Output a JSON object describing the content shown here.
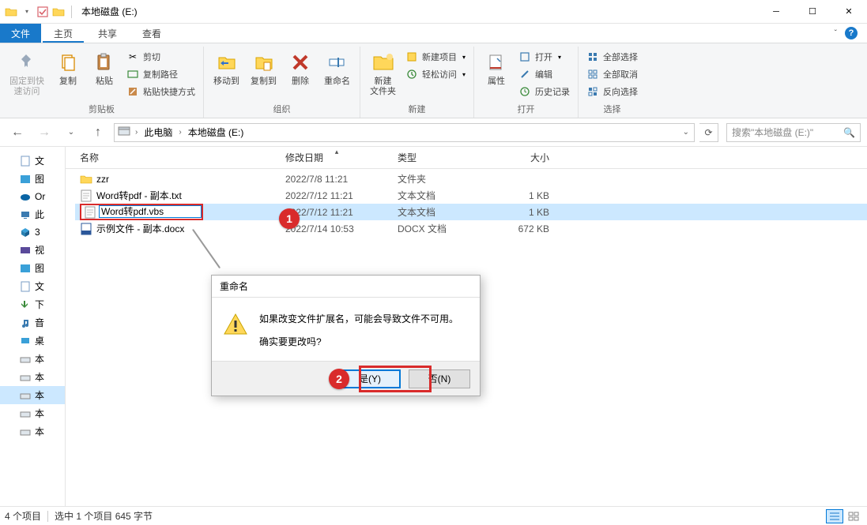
{
  "window": {
    "title": "本地磁盘 (E:)"
  },
  "qat": {
    "checkbox_checked": true
  },
  "tabs": {
    "file": "文件",
    "home": "主页",
    "share": "共享",
    "view": "查看"
  },
  "ribbon": {
    "group_clipboard": "剪贴板",
    "pin": "固定到快\n速访问",
    "copy": "复制",
    "paste": "粘贴",
    "cut": "剪切",
    "copy_path": "复制路径",
    "paste_shortcut": "粘贴快捷方式",
    "group_organize": "组织",
    "move_to": "移动到",
    "copy_to": "复制到",
    "delete": "删除",
    "rename": "重命名",
    "group_new": "新建",
    "new_folder": "新建\n文件夹",
    "new_item": "新建项目",
    "easy_access": "轻松访问",
    "group_open": "打开",
    "properties": "属性",
    "open": "打开",
    "edit": "编辑",
    "history": "历史记录",
    "group_select": "选择",
    "select_all": "全部选择",
    "select_none": "全部取消",
    "invert_selection": "反向选择"
  },
  "nav": {
    "pc": "此电脑",
    "drive": "本地磁盘 (E:)",
    "search_ph": "搜索\"本地磁盘 (E:)\""
  },
  "sidebar": {
    "items": [
      {
        "label": "文",
        "type": "doc"
      },
      {
        "label": "图",
        "type": "pic"
      },
      {
        "label": "Or",
        "type": "cloud"
      },
      {
        "label": "此",
        "type": "pc"
      },
      {
        "label": "3",
        "type": "cube"
      },
      {
        "label": "视",
        "type": "video"
      },
      {
        "label": "图",
        "type": "pic"
      },
      {
        "label": "文",
        "type": "doc"
      },
      {
        "label": "下",
        "type": "download"
      },
      {
        "label": "音",
        "type": "music"
      },
      {
        "label": "桌",
        "type": "desktop"
      },
      {
        "label": "本",
        "type": "drive"
      },
      {
        "label": "本",
        "type": "drive"
      },
      {
        "label": "本",
        "type": "drive",
        "selected": true
      },
      {
        "label": "本",
        "type": "drive"
      },
      {
        "label": "本",
        "type": "drive"
      }
    ]
  },
  "columns": {
    "name": "名称",
    "date": "修改日期",
    "type": "类型",
    "size": "大小"
  },
  "files": [
    {
      "name": "zzr",
      "date": "2022/7/8 11:21",
      "type": "文件夹",
      "size": "",
      "icon": "folder"
    },
    {
      "name": "Word转pdf - 副本.txt",
      "date": "2022/7/12 11:21",
      "type": "文本文档",
      "size": "1 KB",
      "icon": "txt"
    },
    {
      "name": "Word转pdf.vbs",
      "date": "2022/7/12 11:21",
      "type": "文本文档",
      "size": "1 KB",
      "icon": "txt",
      "editing": true,
      "selected": true
    },
    {
      "name": "示例文件 - 副本.docx",
      "date": "2022/7/14 10:53",
      "type": "DOCX 文档",
      "size": "672 KB",
      "icon": "docx"
    }
  ],
  "callouts": {
    "badge1": "1",
    "badge2": "2",
    "vbs": ".vbs"
  },
  "dialog": {
    "title": "重命名",
    "line1": "如果改变文件扩展名，可能会导致文件不可用。",
    "line2": "确实要更改吗?",
    "yes": "是(Y)",
    "no": "否(N)"
  },
  "status": {
    "count": "4 个项目",
    "selected": "选中 1 个项目  645 字节"
  }
}
